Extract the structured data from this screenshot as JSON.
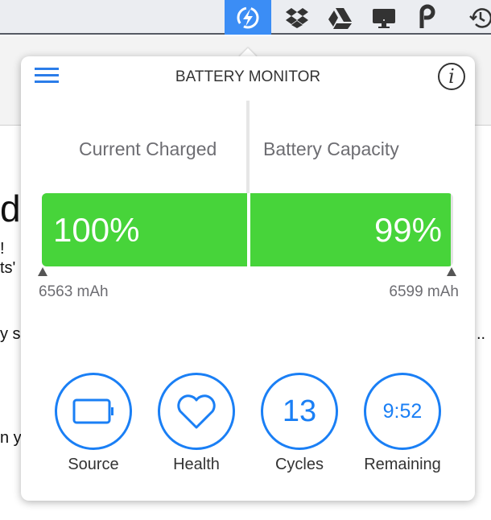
{
  "menubar": {
    "icons": [
      "battery-monitor-icon",
      "dropbox-icon",
      "google-drive-icon",
      "display-icon",
      "p-app-icon",
      "time-machine-icon"
    ],
    "active_color": "#3b8df5"
  },
  "background": {
    "fragments": [
      "d",
      "!",
      "ts'",
      "y s",
      "..",
      "n y"
    ]
  },
  "popup": {
    "title": "BATTERY MONITOR",
    "current_charged": {
      "label": "Current Charged",
      "percent": 100,
      "percent_text": "100%",
      "mah": "6563 mAh"
    },
    "battery_capacity": {
      "label": "Battery Capacity",
      "percent": 99,
      "percent_text": "99%",
      "mah": "6599 mAh"
    },
    "bar_color": "#47d43a",
    "buttons": [
      {
        "label": "Source",
        "icon": "battery-icon"
      },
      {
        "label": "Health",
        "icon": "heart-icon"
      },
      {
        "label": "Cycles",
        "value": "13"
      },
      {
        "label": "Remaining",
        "value": "9:52"
      }
    ],
    "accent": "#1a7ff5"
  }
}
